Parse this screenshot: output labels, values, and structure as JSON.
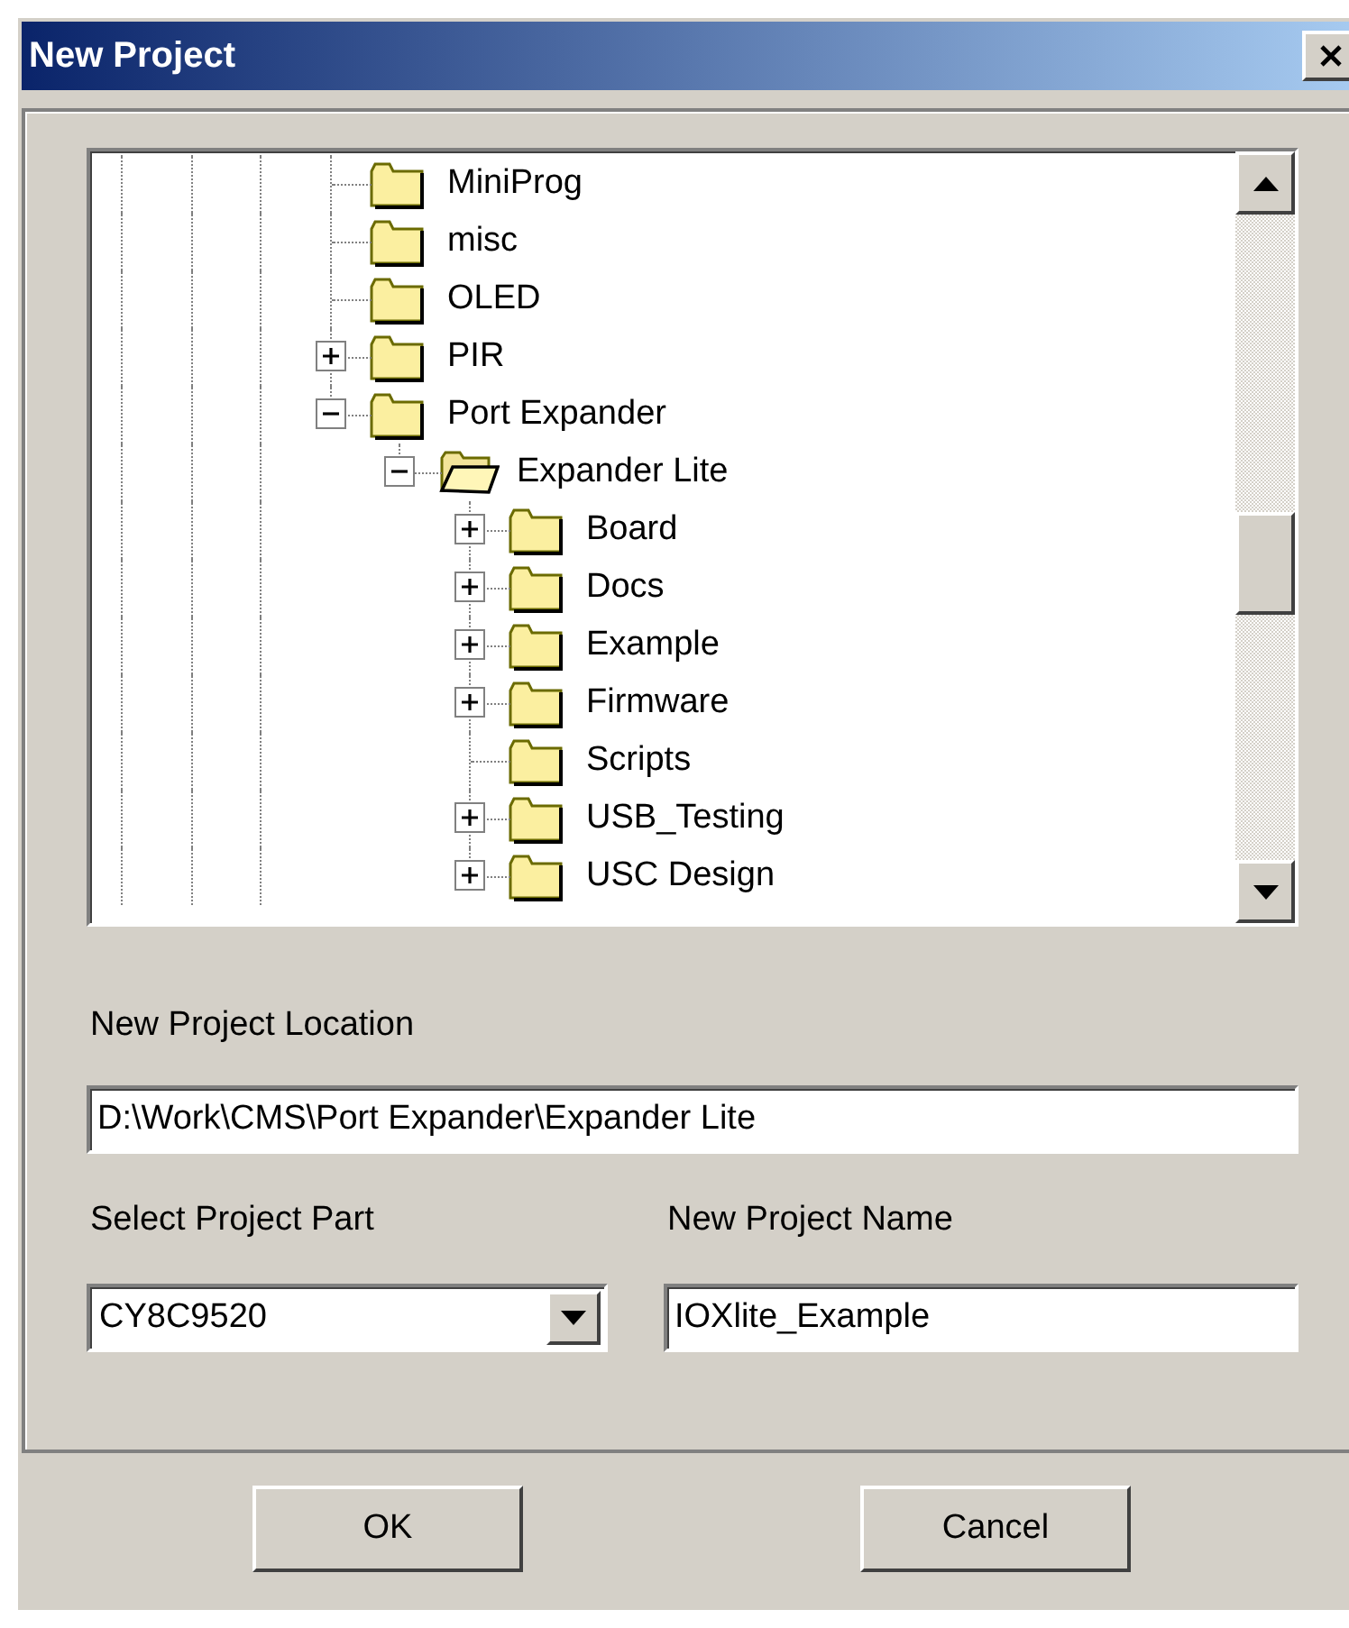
{
  "window": {
    "title": "New Project"
  },
  "tree": {
    "items": [
      {
        "name": "MiniProg",
        "has_children": false,
        "selected": false
      },
      {
        "name": "misc",
        "has_children": false,
        "selected": false
      },
      {
        "name": "OLED",
        "has_children": false,
        "selected": false
      },
      {
        "name": "PIR",
        "has_children": true,
        "expanded": false,
        "selected": false
      },
      {
        "name": "Port Expander",
        "has_children": true,
        "expanded": true,
        "selected": false,
        "children": [
          {
            "name": "Expander Lite",
            "has_children": true,
            "expanded": true,
            "selected": true,
            "children": [
              {
                "name": "Board",
                "has_children": true,
                "expanded": false,
                "selected": false
              },
              {
                "name": "Docs",
                "has_children": true,
                "expanded": false,
                "selected": false
              },
              {
                "name": "Example",
                "has_children": true,
                "expanded": false,
                "selected": false
              },
              {
                "name": "Firmware",
                "has_children": true,
                "expanded": false,
                "selected": false
              },
              {
                "name": "Scripts",
                "has_children": false,
                "selected": false
              },
              {
                "name": "USB_Testing",
                "has_children": true,
                "expanded": false,
                "selected": false
              },
              {
                "name": "USC Design",
                "has_children": true,
                "expanded": false,
                "selected": false
              }
            ]
          }
        ]
      }
    ]
  },
  "location": {
    "label": "New Project Location",
    "value": "D:\\Work\\CMS\\Port Expander\\Expander Lite"
  },
  "part": {
    "label": "Select Project Part",
    "value": "CY8C9520"
  },
  "name": {
    "label": "New Project Name",
    "value": "IOXlite_Example"
  },
  "buttons": [
    "OK",
    "Cancel"
  ]
}
